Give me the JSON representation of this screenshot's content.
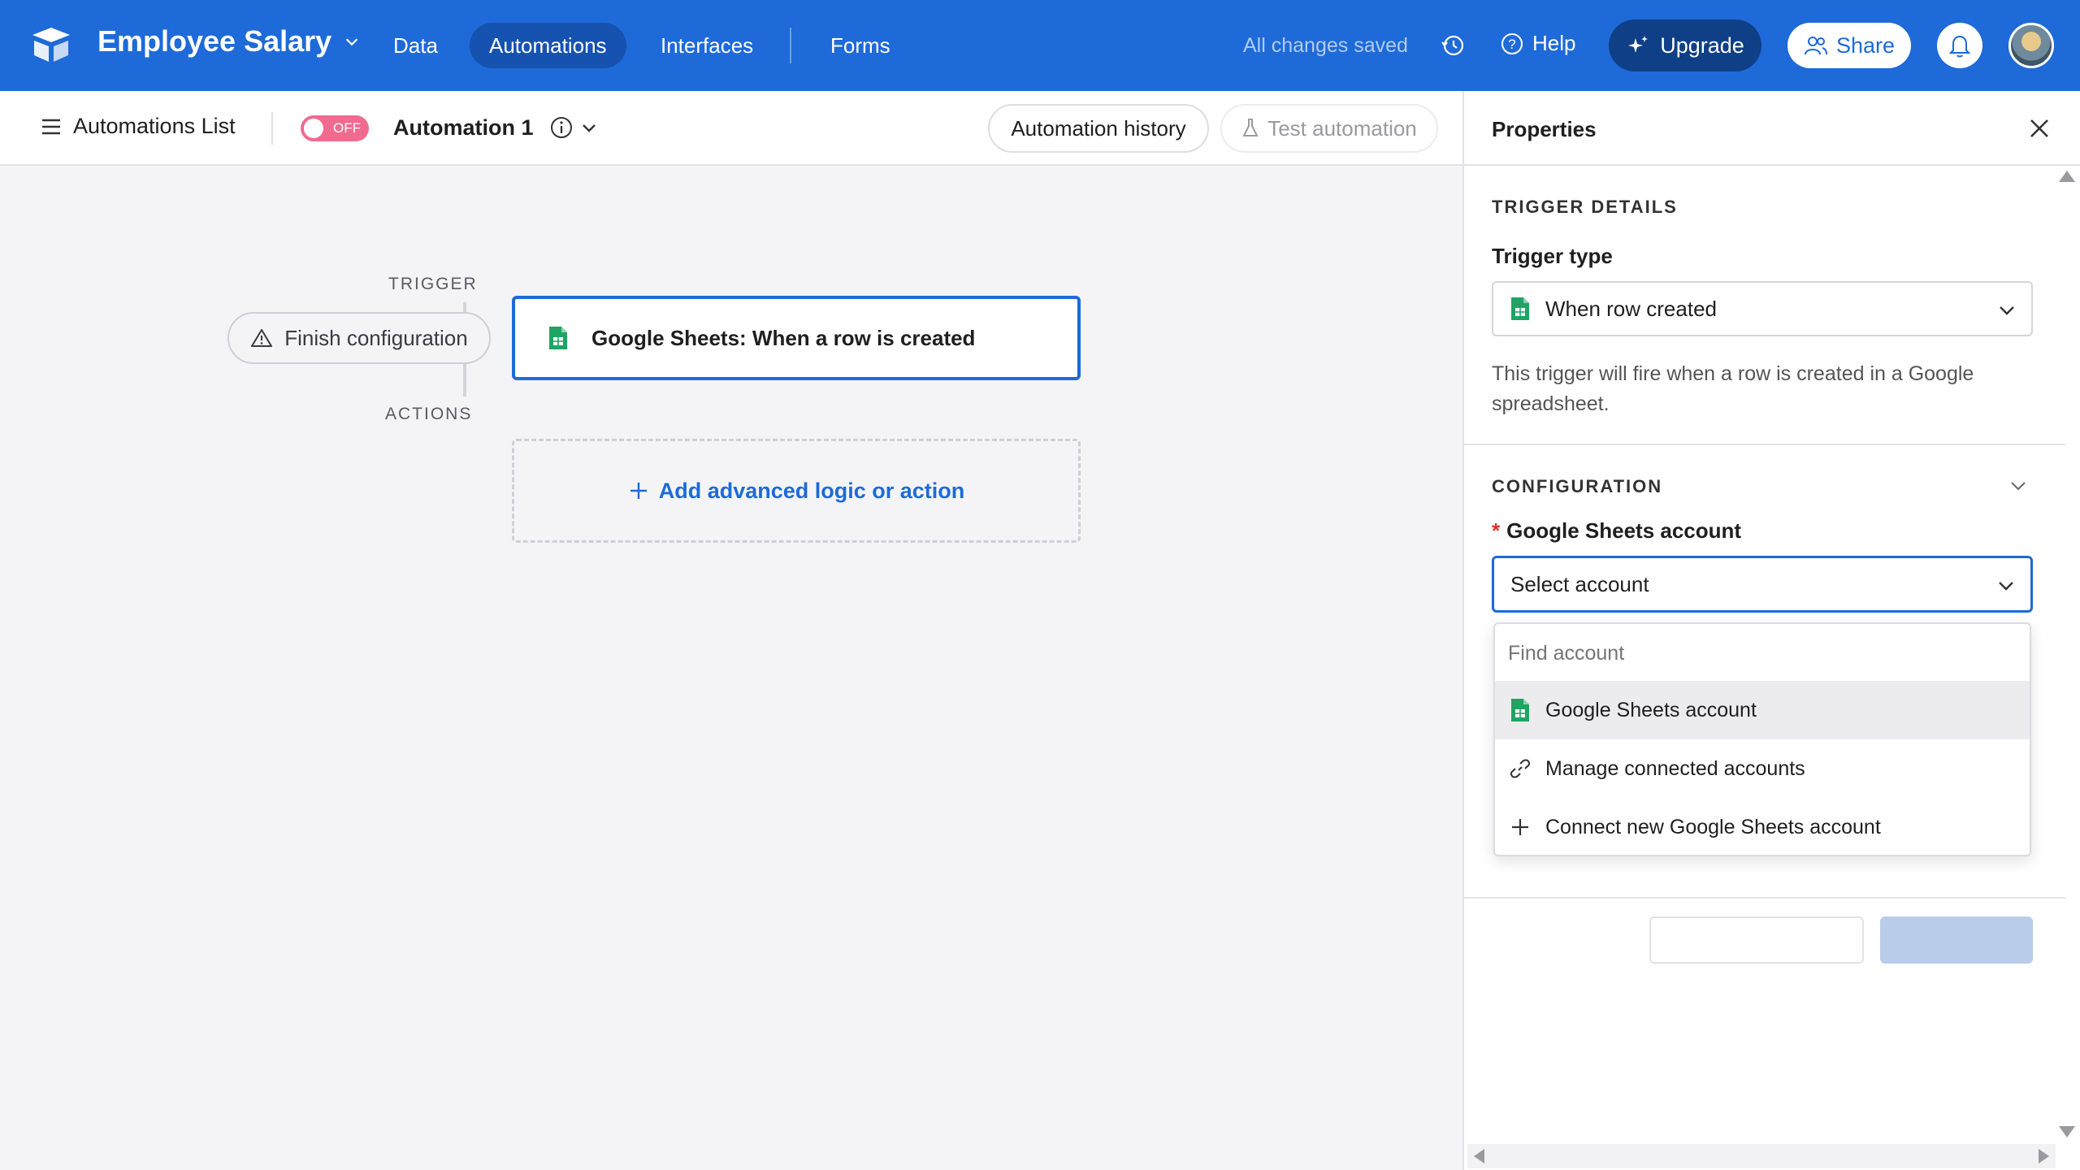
{
  "topbar": {
    "base_name": "Employee Salary",
    "tabs": [
      {
        "label": "Data"
      },
      {
        "label": "Automations",
        "active": true
      },
      {
        "label": "Interfaces"
      },
      {
        "label": "Forms"
      }
    ],
    "save_status": "All changes saved",
    "help_label": "Help",
    "upgrade_label": "Upgrade",
    "share_label": "Share",
    "accent_color": "#1e6ad8"
  },
  "subbar": {
    "list_label": "Automations List",
    "toggle_label": "OFF",
    "automation_name": "Automation 1",
    "history_label": "Automation history",
    "test_label": "Test automation"
  },
  "canvas": {
    "trigger_label": "TRIGGER",
    "actions_label": "ACTIONS",
    "finish_label": "Finish configuration",
    "trigger_card_label": "Google Sheets: When a row is created",
    "add_action_label": "Add advanced logic or action"
  },
  "panel": {
    "title": "Properties",
    "trigger_details_heading": "TRIGGER DETAILS",
    "trigger_type_label": "Trigger type",
    "trigger_type_value": "When row created",
    "trigger_description": "This trigger will fire when a row is created in a Google spreadsheet.",
    "configuration_heading": "CONFIGURATION",
    "account_label": "Google Sheets account",
    "account_placeholder": "Select account",
    "dropdown": {
      "search_placeholder": "Find account",
      "items": [
        {
          "label": "Google Sheets account",
          "icon": "google-sheets-icon",
          "highlighted": true
        },
        {
          "label": "Manage connected accounts",
          "icon": "link-icon"
        },
        {
          "label": "Connect new Google Sheets account",
          "icon": "plus-icon"
        }
      ]
    }
  }
}
